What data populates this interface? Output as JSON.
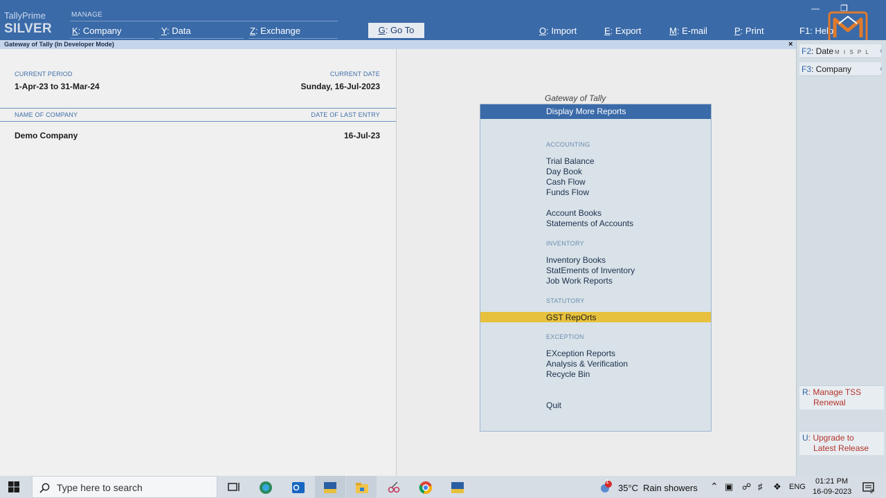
{
  "header": {
    "product_line1": "TallyPrime",
    "product_line2": "SILVER",
    "manage_label": "MANAGE",
    "company_key": "K",
    "company_label": ": Company",
    "data_key": "Y",
    "data_label": ": Data",
    "exchange_key": "Z",
    "exchange_label": ": Exchange",
    "goto_key": "G",
    "goto_label": ": Go To",
    "import_key": "O",
    "import_label": ": Import",
    "export_key": "E",
    "export_label": ": Export",
    "email_key": "M",
    "email_label": ": E-mail",
    "print_key": "P",
    "print_label": ": Print",
    "help_key": "F1",
    "help_label": ": Help",
    "logo_text": "M I S P L"
  },
  "subbar": {
    "title": "Gateway of Tally (In Developer Mode)",
    "close": "×"
  },
  "company_info": {
    "current_period_label": "CURRENT PERIOD",
    "current_period_value": "1-Apr-23 to 31-Mar-24",
    "current_date_label": "CURRENT DATE",
    "current_date_value": "Sunday, 16-Jul-2023",
    "name_col_label": "NAME OF COMPANY",
    "last_entry_col_label": "DATE OF LAST ENTRY",
    "company_name": "Demo Company",
    "last_entry_date": "16-Jul-23"
  },
  "gateway": {
    "title": "Gateway of Tally",
    "header_item": "Display More Reports",
    "sections": {
      "accounting": "ACCOUNTING",
      "inventory": "INVENTORY",
      "statutory": "STATUTORY",
      "exception": "EXCEPTION"
    },
    "items": {
      "trial_balance": "Trial Balance",
      "day_book": "Day Book",
      "cash_flow": "Cash Flow",
      "funds_flow": "Funds Flow",
      "account_books": "Account Books",
      "statements_of_accounts": "Statements of Accounts",
      "inventory_books": "Inventory Books",
      "statements_of_inventory": "StatEments of Inventory",
      "job_work_reports": "Job Work Reports",
      "gst_reports": "GST RepOrts",
      "exception_reports": "EXception Reports",
      "analysis_verification": "Analysis & Verification",
      "recycle_bin": "Recycle Bin",
      "quit": "Quit"
    }
  },
  "side_buttons": {
    "date_key": "F2",
    "date_label": ": Date",
    "company_key": "F3",
    "company_label": ": Company",
    "tss_key": "R",
    "tss_label_1": ": Manage TSS",
    "tss_label_2": "Renewal",
    "upgrade_key": "U",
    "upgrade_label_1": ": Upgrade to",
    "upgrade_label_2": "Latest Release"
  },
  "taskbar": {
    "search_placeholder": "Type here to search",
    "weather_temp": "35°C",
    "weather_desc": "Rain showers",
    "language": "ENG",
    "time": "01:21 PM",
    "date": "16-09-2023",
    "notification_count": "1",
    "action_center_count": "2"
  },
  "colors": {
    "accent_blue": "#3a6aa8",
    "highlight_yellow": "#e8c13c",
    "menu_bg": "#d8e2e8"
  }
}
